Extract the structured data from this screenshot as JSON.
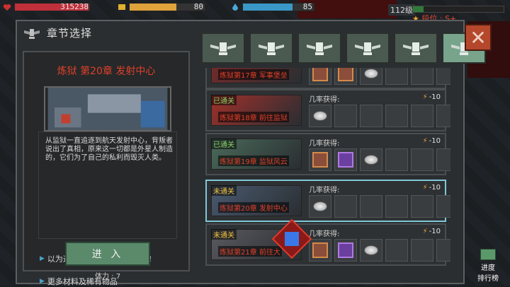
{
  "hud": {
    "hp_value": "315238",
    "hp_fraction": 0.98,
    "energy_value": "80",
    "energy_fraction": 0.62,
    "water_value": "85",
    "water_fraction": 0.7,
    "level_text": "112级",
    "level_fraction": 0.12,
    "rank_text": "段位 : S+"
  },
  "panel": {
    "title": "章节选择",
    "close_label": "✕",
    "tabs": [
      {
        "icon": "trophy-wings-icon",
        "active": false
      },
      {
        "icon": "trophy-wings-icon",
        "active": false
      },
      {
        "icon": "trophy-wings-icon",
        "active": false
      },
      {
        "icon": "trophy-wings-icon",
        "active": false
      },
      {
        "icon": "gem-wings-icon",
        "active": false
      },
      {
        "icon": "wings-icon",
        "active": true
      }
    ]
  },
  "detail": {
    "chapter_title": "炼狱 第20章 发射中心",
    "description": "从监狱一直追逐到航天发射中心，背叛者说出了真相，原来这一切都是外星人制造的，它们为了自己的私利而毁灭人类。",
    "bullet1": "以为这就是终结？还有更难的!",
    "bullet2": "更多材料及稀有物品",
    "enter_label": "进 入",
    "stamina_text": "体力 : 7"
  },
  "chapters": [
    {
      "status": "",
      "name": "炼狱第17章 军事堡垒",
      "drop_label": "",
      "cost": "",
      "selected": false
    },
    {
      "status": "已通关",
      "status_type": "cleared",
      "name": "炼狱第18章 前往监狱",
      "drop_label": "几率获得:",
      "cost": "-10",
      "selected": false
    },
    {
      "status": "已通关",
      "status_type": "cleared",
      "name": "炼狱第19章 监狱风云",
      "drop_label": "几率获得:",
      "cost": "-10",
      "selected": false
    },
    {
      "status": "未通关",
      "status_type": "locked",
      "name": "炼狱第20章 发射中心",
      "drop_label": "几率获得:",
      "cost": "-10",
      "selected": true
    },
    {
      "status": "未通关",
      "status_type": "locked",
      "name": "炼狱第21章 前往大",
      "drop_label": "几率获得:",
      "cost": "-10",
      "selected": false
    }
  ],
  "leaderboard": {
    "line1": "进度",
    "line2": "排行榜"
  },
  "colors": {
    "accent_red": "#e0402a",
    "cleared_green": "#8ed26a",
    "locked_yellow": "#f3c541",
    "select_cyan": "#7ec8d8",
    "tab_active": "#78a48c"
  }
}
